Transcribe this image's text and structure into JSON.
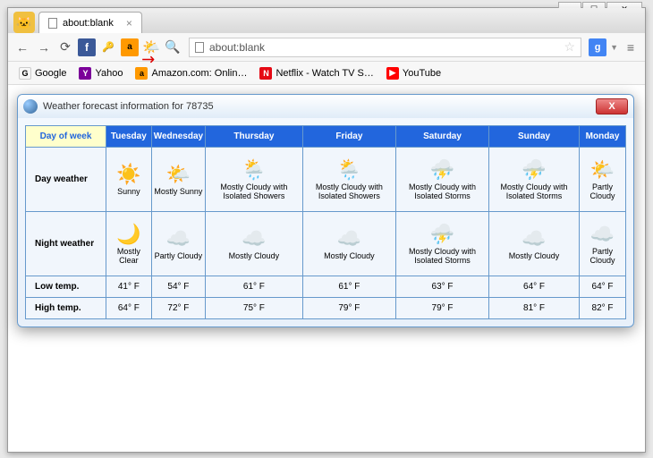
{
  "window": {
    "minimize_label": "─",
    "maximize_label": "☐",
    "close_label": "✕"
  },
  "tab": {
    "title": "about:blank",
    "close": "×"
  },
  "nav": {
    "back": "←",
    "forward": "→",
    "reload": "⟳"
  },
  "url": {
    "value": "about:blank"
  },
  "bookmarks": [
    {
      "label": "Google"
    },
    {
      "label": "Yahoo"
    },
    {
      "label": "Amazon.com: Onlin…"
    },
    {
      "label": "Netflix - Watch TV S…"
    },
    {
      "label": "YouTube"
    }
  ],
  "popup": {
    "title": "Weather forecast information for 78735",
    "close": "X"
  },
  "forecast": {
    "row_head": "Day of week",
    "day_label": "Day weather",
    "night_label": "Night weather",
    "low_label": "Low temp.",
    "high_label": "High temp.",
    "days": [
      {
        "name": "Tuesday",
        "day_icon": "☀️",
        "day_desc": "Sunny",
        "night_icon": "🌙",
        "night_desc": "Mostly Clear",
        "low": "41° F",
        "high": "64° F"
      },
      {
        "name": "Wednesday",
        "day_icon": "🌤️",
        "day_desc": "Mostly Sunny",
        "night_icon": "☁️",
        "night_desc": "Partly Cloudy",
        "low": "54° F",
        "high": "72° F"
      },
      {
        "name": "Thursday",
        "day_icon": "🌦️",
        "day_desc": "Mostly Cloudy with Isolated Showers",
        "night_icon": "☁️",
        "night_desc": "Mostly Cloudy",
        "low": "61° F",
        "high": "75° F"
      },
      {
        "name": "Friday",
        "day_icon": "🌦️",
        "day_desc": "Mostly Cloudy with Isolated Showers",
        "night_icon": "☁️",
        "night_desc": "Mostly Cloudy",
        "low": "61° F",
        "high": "79° F"
      },
      {
        "name": "Saturday",
        "day_icon": "⛈️",
        "day_desc": "Mostly Cloudy with Isolated Storms",
        "night_icon": "⛈️",
        "night_desc": "Mostly Cloudy with Isolated Storms",
        "low": "63° F",
        "high": "79° F"
      },
      {
        "name": "Sunday",
        "day_icon": "⛈️",
        "day_desc": "Mostly Cloudy with Isolated Storms",
        "night_icon": "☁️",
        "night_desc": "Mostly Cloudy",
        "low": "64° F",
        "high": "81° F"
      },
      {
        "name": "Monday",
        "day_icon": "🌤️",
        "day_desc": "Partly Cloudy",
        "night_icon": "☁️",
        "night_desc": "Partly Cloudy",
        "low": "64° F",
        "high": "82° F"
      }
    ]
  }
}
